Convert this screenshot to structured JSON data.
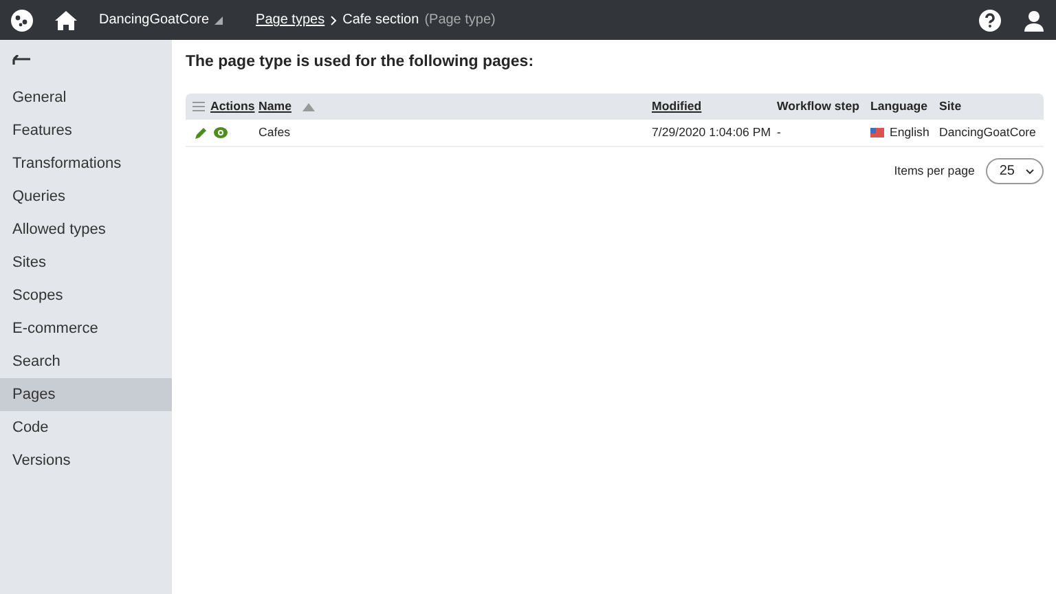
{
  "header": {
    "site": "DancingGoatCore",
    "breadcrumbs": [
      {
        "label": "Page types",
        "link": true
      },
      {
        "label": "Cafe section",
        "link": false
      }
    ],
    "breadcrumb_note": "(Page type)"
  },
  "sidebar": {
    "items": [
      {
        "label": "General",
        "selected": false
      },
      {
        "label": "Features",
        "selected": false
      },
      {
        "label": "Transformations",
        "selected": false
      },
      {
        "label": "Queries",
        "selected": false
      },
      {
        "label": "Allowed types",
        "selected": false
      },
      {
        "label": "Sites",
        "selected": false
      },
      {
        "label": "Scopes",
        "selected": false
      },
      {
        "label": "E-commerce",
        "selected": false
      },
      {
        "label": "Search",
        "selected": false
      },
      {
        "label": "Pages",
        "selected": true
      },
      {
        "label": "Code",
        "selected": false
      },
      {
        "label": "Versions",
        "selected": false
      }
    ]
  },
  "heading": "The page type is used for the following pages:",
  "table": {
    "columns": [
      {
        "label": "Actions",
        "sortable": true,
        "sorted": false
      },
      {
        "label": "Name",
        "sortable": true,
        "sorted": true
      },
      {
        "label": "Modified",
        "sortable": true,
        "sorted": false
      },
      {
        "label": "Workflow step",
        "sortable": false,
        "sorted": false
      },
      {
        "label": "Language",
        "sortable": false,
        "sorted": false
      },
      {
        "label": "Site",
        "sortable": false,
        "sorted": false
      }
    ],
    "rows": [
      {
        "name": "Cafes",
        "modified": "7/29/2020 1:04:06 PM",
        "workflow_step": "-",
        "language": "English",
        "site": "DancingGoatCore"
      }
    ]
  },
  "pager": {
    "label": "Items per page",
    "value": "25"
  }
}
